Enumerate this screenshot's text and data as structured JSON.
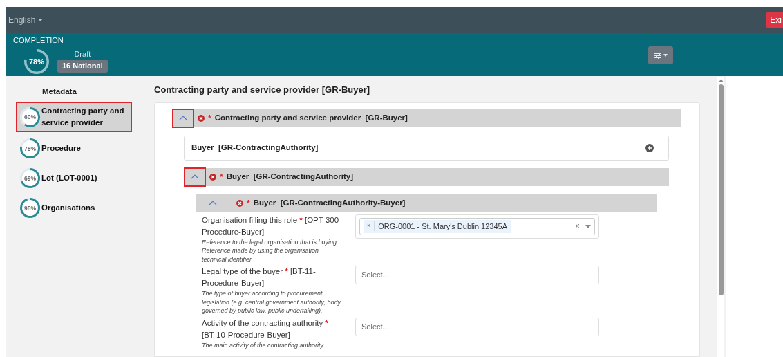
{
  "top_bar": {
    "language": "English",
    "exit_button": "Exi"
  },
  "header": {
    "completion_label": "COMPLETION",
    "completion": {
      "text": "78%",
      "level": 0.78
    },
    "status": "Draft",
    "badge": "16 National"
  },
  "sidebar": {
    "heading": "Metadata",
    "items": [
      {
        "label": "Contracting party and service provider",
        "percent": "60%",
        "level": 0.6,
        "selected": true
      },
      {
        "label": "Procedure",
        "percent": "78%",
        "level": 0.78,
        "selected": false
      },
      {
        "label": "Lot (LOT-0001)",
        "percent": "69%",
        "level": 0.69,
        "selected": false
      },
      {
        "label": "Organisations",
        "percent": "95%",
        "level": 0.95,
        "selected": false
      }
    ]
  },
  "main": {
    "title": "Contracting party and service provider [GR-Buyer]",
    "sections": [
      {
        "kind": "header",
        "title": "Contracting party and service provider",
        "code": "[GR-Buyer]",
        "required_mark": "*",
        "expanded": true,
        "highlighted": true
      },
      {
        "kind": "row",
        "title": "Buyer",
        "code": "[GR-ContractingAuthority]"
      },
      {
        "kind": "header",
        "title": "Buyer",
        "code": "[GR-ContractingAuthority]",
        "required_mark": "*",
        "expanded": true,
        "highlighted": true
      },
      {
        "kind": "subheader",
        "title": "Buyer",
        "code": "[GR-ContractingAuthority-Buyer]",
        "required_mark": "*",
        "expanded": true,
        "highlighted": false
      }
    ],
    "fields": [
      {
        "kind": "multiselect",
        "label": "Organisation filling this role",
        "required_mark": "*",
        "code": "[OPT-300-Procedure-Buyer]",
        "description": "Reference to the legal organisation that is buying. Reference made by using the organisation technical identifier.",
        "tags": [
          "ORG-0001 - St. Mary's Dublin 12345A"
        ],
        "tag_remove_icon": "×",
        "clear_icon": "×"
      },
      {
        "kind": "select",
        "label": "Legal type of the buyer",
        "required_mark": "*",
        "code": "[BT-11-Procedure-Buyer]",
        "description": "The type of buyer according to procurement legislation (e.g. central government authority, body governed by public law, public undertaking).",
        "placeholder": "Select..."
      },
      {
        "kind": "select",
        "label": "Activity of the contracting authority",
        "required_mark": "*",
        "code": "[BT-10-Procedure-Buyer]",
        "description": "The main activity of the contracting authority",
        "placeholder": "Select..."
      }
    ]
  }
}
